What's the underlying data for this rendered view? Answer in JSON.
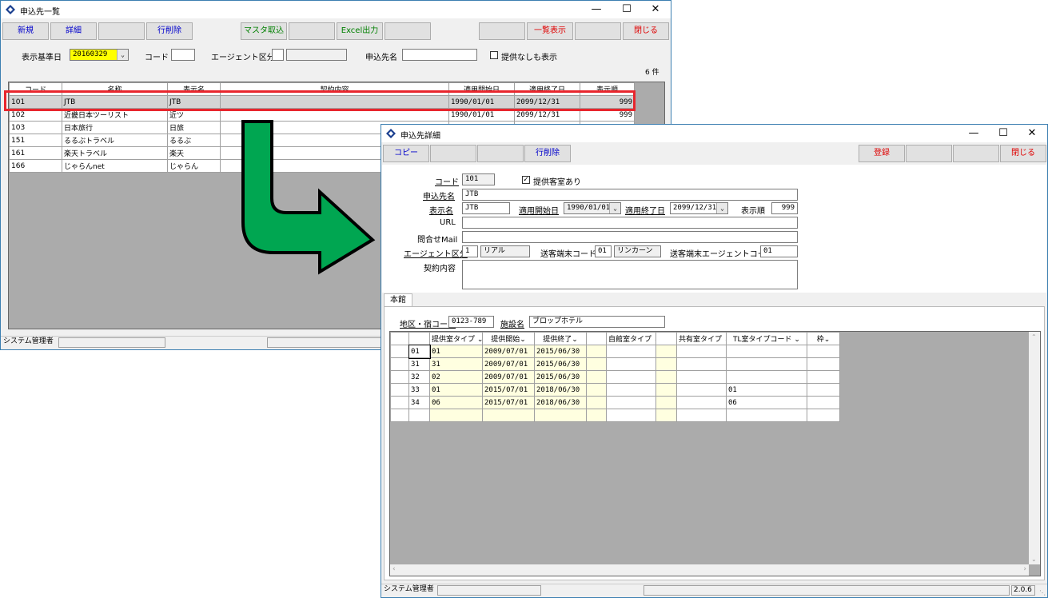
{
  "list_window": {
    "title": "申込先一覧",
    "toolbar": {
      "new": "新規",
      "detail": "詳細",
      "delete_row": "行削除",
      "import_master": "マスタ取込",
      "excel_output": "Excel出力",
      "list_display": "一覧表示",
      "close": "閉じる"
    },
    "filters": {
      "date_label": "表示基準日",
      "date_value": "20160329",
      "code_label": "コード",
      "code_value": "",
      "agent_label": "エージェント区分",
      "agent_value": "",
      "name_label": "申込先名",
      "name_value": "",
      "show_no_offer_label": "提供なしも表示"
    },
    "count": "6 件",
    "columns": [
      "コード",
      "名称",
      "表示名",
      "契約内容",
      "適用開始日",
      "適用終了日",
      "表示順"
    ],
    "rows": [
      [
        "101",
        "JTB",
        "JTB",
        "",
        "1990/01/01",
        "2099/12/31",
        "999"
      ],
      [
        "102",
        "近畿日本ツーリスト",
        "近ツ",
        "",
        "1990/01/01",
        "2099/12/31",
        "999"
      ],
      [
        "103",
        "日本旅行",
        "日旅",
        "",
        "",
        "",
        ""
      ],
      [
        "151",
        "るるぶトラベル",
        "るるぶ",
        "",
        "",
        "",
        ""
      ],
      [
        "161",
        "楽天トラベル",
        "楽天",
        "",
        "",
        "",
        ""
      ],
      [
        "166",
        "じゃらんnet",
        "じゃらん",
        "",
        "",
        "",
        ""
      ]
    ],
    "status": {
      "user": "システム管理者"
    }
  },
  "detail_window": {
    "title": "申込先詳細",
    "toolbar": {
      "copy": "コピー",
      "delete_row": "行削除",
      "register": "登録",
      "close": "閉じる"
    },
    "form": {
      "code_label": "コード",
      "code_value": "101",
      "offer_room_label": "提供客室あり",
      "name_label": "申込先名",
      "name_value": "JTB",
      "display_name_label": "表示名",
      "display_name_value": "JTB",
      "start_label": "適用開始日",
      "start_value": "1990/01/01",
      "end_label": "適用終了日",
      "end_value": "2099/12/31",
      "order_label": "表示順",
      "order_value": "999",
      "url_label": "URL",
      "url_value": "",
      "mail_label": "問合せMail",
      "mail_value": "",
      "agent_label": "エージェント区分",
      "agent_code": "1",
      "agent_name": "リアル",
      "terminal_label": "送客端末コード",
      "terminal_code": "01",
      "terminal_name": "リンカーン",
      "terminal_agent_label": "送客端末エージェントコード",
      "terminal_agent_value": "01",
      "contract_label": "契約内容",
      "contract_value": ""
    },
    "tab": "本館",
    "facility": {
      "area_label": "地区・宿コード",
      "area_value": "0123-789",
      "facility_label": "施設名",
      "facility_value": "ブロップホテル"
    },
    "columns": [
      "",
      "提供室タイプ",
      "提供開始",
      "提供終了",
      "",
      "自館室タイプ",
      "",
      "共有室タイプ",
      "TL室タイプコード",
      "枠"
    ],
    "rows": [
      [
        "01",
        "01",
        "2009/07/01",
        "2015/06/30",
        "",
        "",
        "",
        "",
        "",
        ""
      ],
      [
        "31",
        "31",
        "2009/07/01",
        "2015/06/30",
        "",
        "",
        "",
        "",
        "",
        ""
      ],
      [
        "32",
        "02",
        "2009/07/01",
        "2015/06/30",
        "",
        "",
        "",
        "",
        "",
        ""
      ],
      [
        "33",
        "01",
        "2015/07/01",
        "2018/06/30",
        "",
        "",
        "",
        "",
        "01",
        ""
      ],
      [
        "34",
        "06",
        "2015/07/01",
        "2018/06/30",
        "",
        "",
        "",
        "",
        "06",
        ""
      ],
      [
        "",
        "",
        "",
        "",
        "",
        "",
        "",
        "",
        "",
        ""
      ]
    ],
    "status": {
      "user": "システム管理者",
      "version": "2.0.6"
    }
  },
  "colors": {
    "highlight_red": "#e8262d",
    "arrow_green": "#00a651",
    "cell_yellow": "#ffffe0"
  }
}
